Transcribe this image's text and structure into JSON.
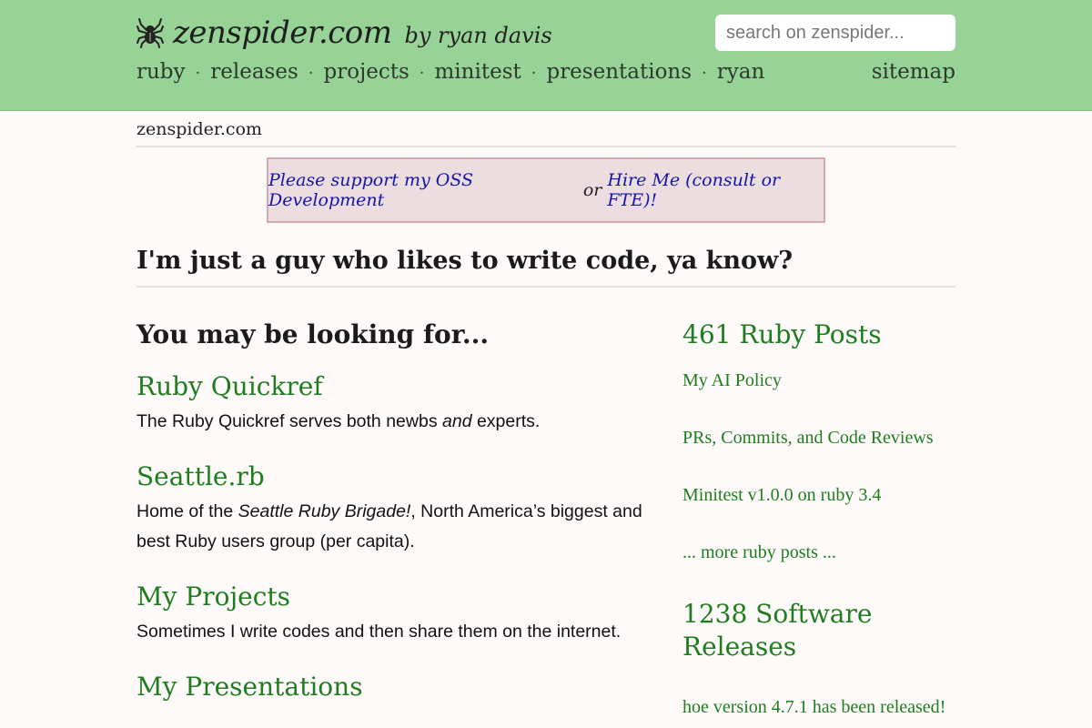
{
  "header": {
    "site_title": "zenspider.com",
    "byline": "by ryan davis",
    "search_placeholder": "search on zenspider...",
    "nav": [
      "ruby",
      "releases",
      "projects",
      "minitest",
      "presentations",
      "ryan"
    ],
    "nav_separator": "·",
    "sitemap": "sitemap"
  },
  "breadcrumb": "zenspider.com",
  "support": {
    "link1": "Please support my OSS Development",
    "or": "or",
    "link2": "Hire Me (consult or FTE)!"
  },
  "tagline": "I'm just a guy who likes to write code, ya know?",
  "left": {
    "heading": "You may be looking for...",
    "items": [
      {
        "title": "Ruby Quickref",
        "desc_a": "The Ruby Quickref serves both newbs ",
        "desc_em": "and",
        "desc_b": " experts."
      },
      {
        "title": "Seattle.rb",
        "desc_a": "Home of the ",
        "desc_em": "Seattle Ruby Brigade!",
        "desc_b": ", North America’s biggest and best Ruby users group (per capita)."
      },
      {
        "title": "My Projects",
        "desc_a": "Sometimes I write codes and then share them on the internet.",
        "desc_em": "",
        "desc_b": ""
      },
      {
        "title": "My Presentations",
        "desc_a": "",
        "desc_em": "",
        "desc_b": ""
      }
    ]
  },
  "right": {
    "posts_heading": "461 Ruby Posts",
    "posts": [
      "My AI Policy",
      "PRs, Commits, and Code Reviews",
      "Minitest v1.0.0 on ruby 3.4"
    ],
    "more_posts": "... more ruby posts ...",
    "releases_heading": "1238 Software Releases",
    "releases": [
      "hoe version 4.7.1 has been released!"
    ]
  },
  "colors": {
    "header_bg": "#97d296",
    "link_green": "#1f7d1f",
    "support_bg": "#ecdde0",
    "support_link": "#1515a8",
    "page_bg": "#fefaf9"
  }
}
